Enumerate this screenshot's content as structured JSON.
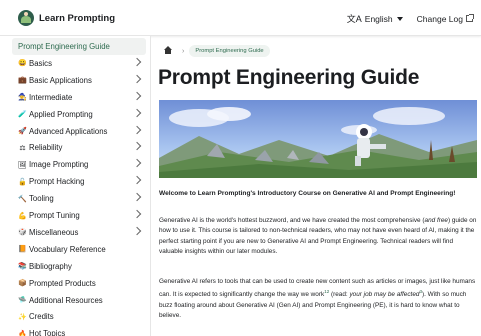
{
  "navbar": {
    "brand": "Learn Prompting",
    "language": "English",
    "changelog": "Change Log"
  },
  "sidebar": {
    "items": [
      {
        "label": "Prompt Engineering Guide",
        "emoji": "",
        "active": true,
        "chevron": false
      },
      {
        "label": "Basics",
        "emoji": "😀",
        "chevron": true
      },
      {
        "label": "Basic Applications",
        "emoji": "💼",
        "chevron": true
      },
      {
        "label": "Intermediate",
        "emoji": "🧙",
        "chevron": true
      },
      {
        "label": "Applied Prompting",
        "emoji": "🧪",
        "chevron": true
      },
      {
        "label": "Advanced Applications",
        "emoji": "🚀",
        "chevron": true
      },
      {
        "label": "Reliability",
        "emoji": "⚖",
        "chevron": true
      },
      {
        "label": "Image Prompting",
        "emoji": "🖼",
        "chevron": true
      },
      {
        "label": "Prompt Hacking",
        "emoji": "🔓",
        "chevron": true
      },
      {
        "label": "Tooling",
        "emoji": "🔨",
        "chevron": true
      },
      {
        "label": "Prompt Tuning",
        "emoji": "💪",
        "chevron": true
      },
      {
        "label": "Miscellaneous",
        "emoji": "🎲",
        "chevron": true
      },
      {
        "label": "Vocabulary Reference",
        "emoji": "📙",
        "chevron": false
      },
      {
        "label": "Bibliography",
        "emoji": "📚",
        "chevron": false
      },
      {
        "label": "Prompted Products",
        "emoji": "📦",
        "chevron": false
      },
      {
        "label": "Additional Resources",
        "emoji": "🛸",
        "chevron": false
      },
      {
        "label": "Credits",
        "emoji": "✨",
        "chevron": false
      },
      {
        "label": "Hot Topics",
        "emoji": "🔥",
        "chevron": false
      }
    ]
  },
  "main": {
    "breadcrumb": "Prompt Engineering Guide",
    "title": "Prompt Engineering Guide",
    "intro": "Welcome to Learn Prompting's Introductory Course on Generative AI and Prompt Engineering!",
    "para1_a": "Generative AI is the world's hottest buzzword, and we have created the most comprehensive (",
    "para1_em": "and free",
    "para1_b": ") guide on how to use it. This course is tailored to non-technical readers, who may not have even heard of AI, making it the perfect starting point if you are new to Generative AI and Prompt Engineering. Technical readers will find valuable insights within our later modules.",
    "para2_a": "Generative AI refers to tools that can be used to create new content such as articles or images, just like humans can. It is expected to significantly change the way we work",
    "para2_sup": "12",
    "para2_b": " (read: ",
    "para2_em": "your job may be affected",
    "para2_sup2": "3",
    "para2_c": "). With so much buzz floating around about Generative AI (Gen AI) and Prompt Engineering (PE), it is hard to know what to believe."
  },
  "colors": {
    "accent": "#2e6b4f",
    "active_bg": "#f0f2f1"
  }
}
